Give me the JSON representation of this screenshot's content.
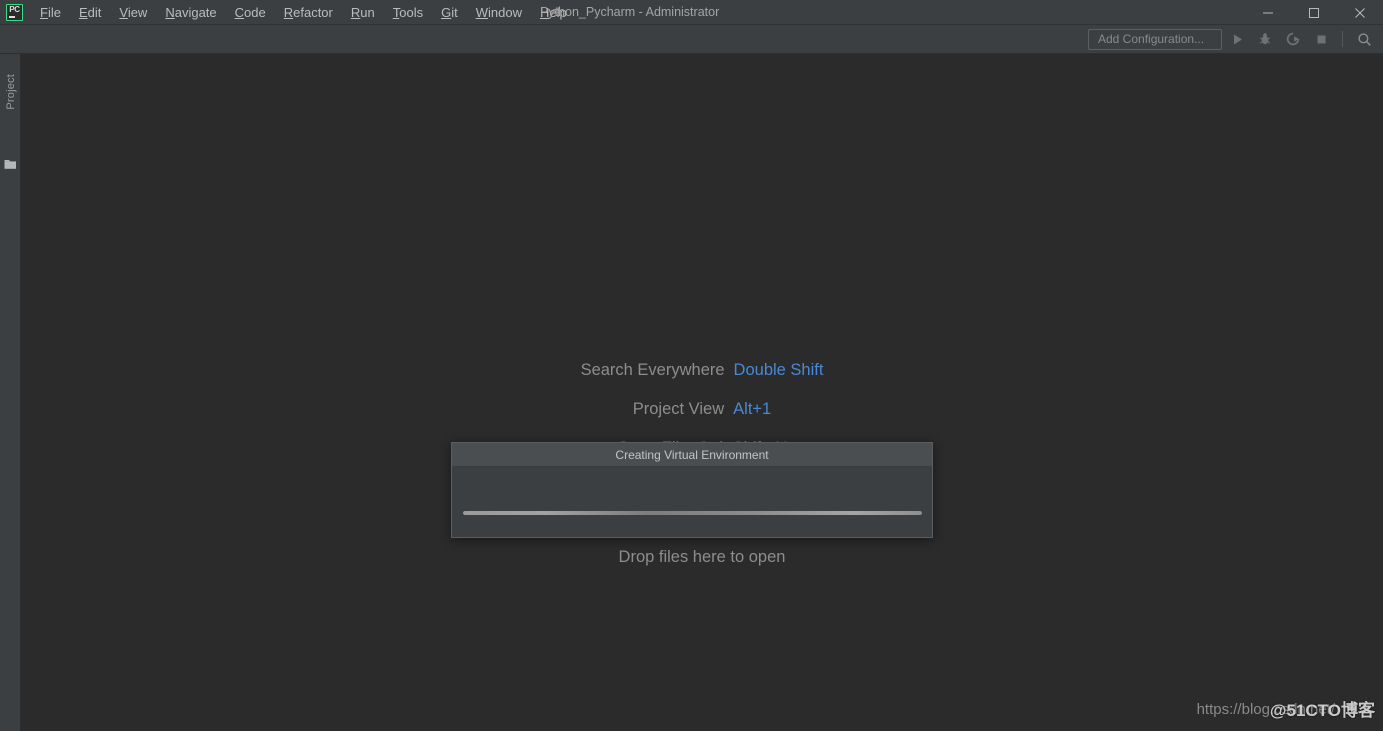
{
  "window": {
    "title": "Python_Pycharm - Administrator",
    "app_icon_label": "PC",
    "controls": {
      "minimize": "minimize-button",
      "maximize": "maximize-button",
      "close": "close-button"
    }
  },
  "menubar": {
    "items": [
      {
        "label": "File",
        "mnemonic": "F"
      },
      {
        "label": "Edit",
        "mnemonic": "E"
      },
      {
        "label": "View",
        "mnemonic": "V"
      },
      {
        "label": "Navigate",
        "mnemonic": "N"
      },
      {
        "label": "Code",
        "mnemonic": "C"
      },
      {
        "label": "Refactor",
        "mnemonic": "R"
      },
      {
        "label": "Run",
        "mnemonic": "R"
      },
      {
        "label": "Tools",
        "mnemonic": "T"
      },
      {
        "label": "Git",
        "mnemonic": "G"
      },
      {
        "label": "Window",
        "mnemonic": "W"
      },
      {
        "label": "Help",
        "mnemonic": "H"
      }
    ]
  },
  "toolbar": {
    "add_configuration_label": "Add Configuration...",
    "buttons": [
      {
        "name": "run-button",
        "icon": "play-icon"
      },
      {
        "name": "debug-button",
        "icon": "bug-icon"
      },
      {
        "name": "run-coverage-button",
        "icon": "run-coverage-icon"
      },
      {
        "name": "stop-button",
        "icon": "stop-icon"
      },
      {
        "name": "search-button",
        "icon": "search-icon"
      }
    ]
  },
  "sidebar": {
    "tabs": [
      {
        "label": "Project",
        "name": "sidebar-item-project"
      }
    ],
    "folder_icon": "folder-icon"
  },
  "editor": {
    "hints": [
      {
        "label": "Search Everywhere",
        "key": "Double Shift"
      },
      {
        "label": "Project View",
        "key": "Alt+1"
      },
      {
        "label": "Go to File",
        "key": "Ctrl+Shift+N"
      }
    ],
    "drop_text": "Drop files here to open"
  },
  "dialog": {
    "title": "Creating Virtual Environment",
    "progress_indeterminate": true
  },
  "watermarks": {
    "csdn": "https://blog.csdn.net/",
    "cto": "@51CTO博客"
  },
  "colors": {
    "editor_background": "#2b2b2b",
    "chrome_background": "#3c3f41",
    "dialog_title_background": "#4b4e51",
    "hint_key_accent": "#4a88d6",
    "icon_accent_green": "#3ddb85",
    "text_muted": "#8d8d8d"
  }
}
